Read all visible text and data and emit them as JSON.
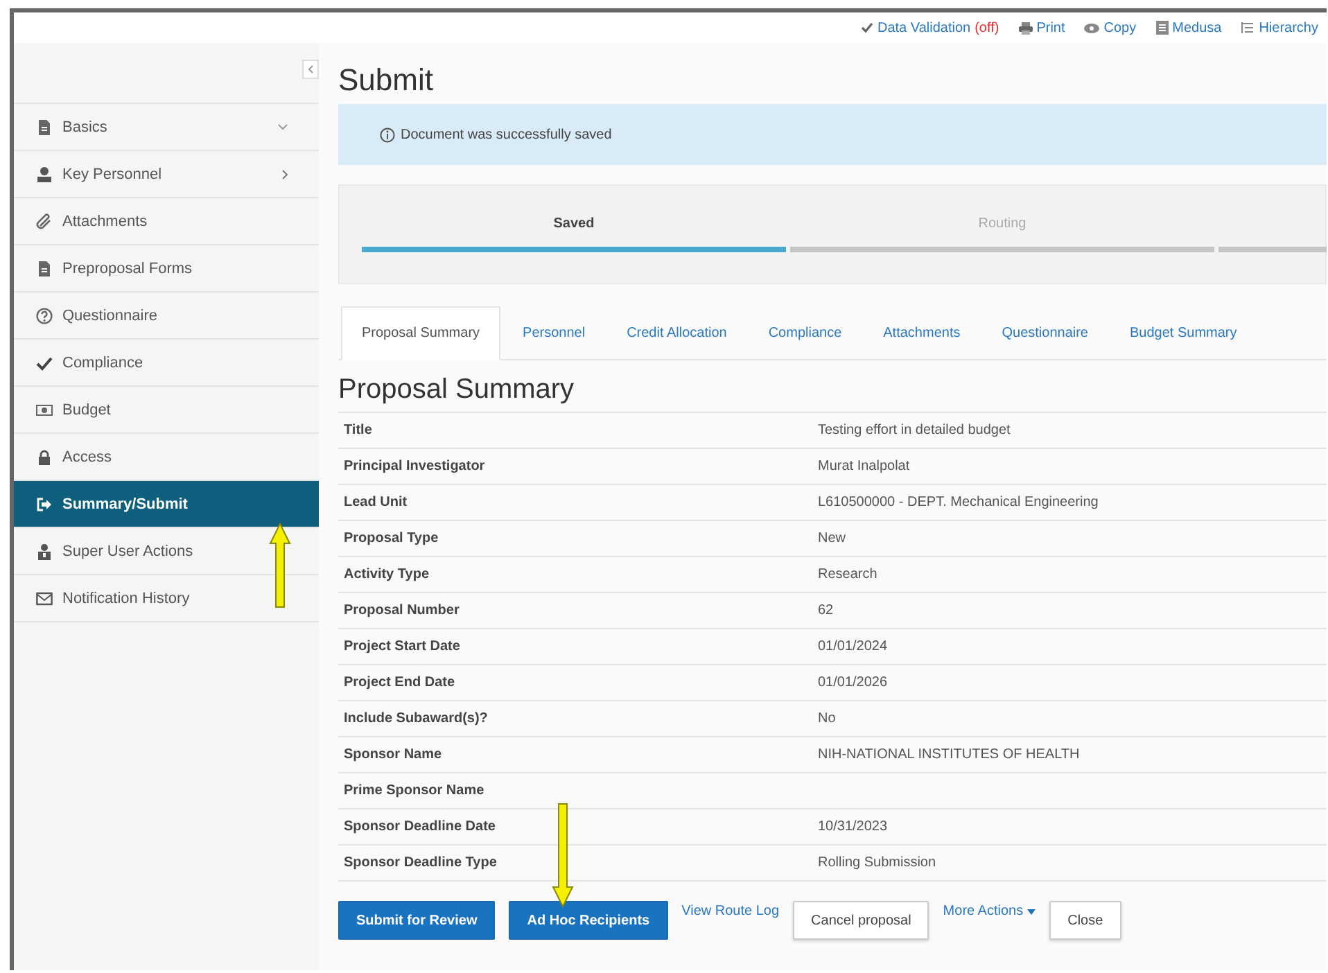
{
  "top_links": [
    {
      "kind": "check",
      "label": "Data Validation",
      "status": "(off)"
    },
    {
      "kind": "print",
      "label": "Print"
    },
    {
      "kind": "eye",
      "label": "Copy"
    },
    {
      "kind": "doc",
      "label": "Medusa"
    },
    {
      "kind": "tree",
      "label": "Hierarchy"
    }
  ],
  "sidebar": {
    "items": [
      {
        "label": "Basics",
        "expanded": true,
        "selected": false
      },
      {
        "label": "Key Personnel",
        "expanded": false,
        "selected": false
      },
      {
        "label": "Attachments",
        "selected": false
      },
      {
        "label": "Preproposal Forms",
        "selected": false
      },
      {
        "label": "Questionnaire",
        "selected": false
      },
      {
        "label": "Compliance",
        "selected": false
      },
      {
        "label": "Budget",
        "selected": false
      },
      {
        "label": "Access",
        "selected": false
      },
      {
        "label": "Summary/Submit",
        "selected": true
      },
      {
        "label": "Super User Actions",
        "selected": false
      },
      {
        "label": "Notification History",
        "selected": false
      }
    ]
  },
  "page_title": "Submit",
  "alert": "Document was successfully saved",
  "progress_steps": [
    {
      "label": "Saved",
      "completed": true
    },
    {
      "label": "Routing",
      "completed": false
    },
    {
      "completed": false
    }
  ],
  "tabs": [
    {
      "label": "Proposal Summary",
      "selected": true
    },
    {
      "label": "Personnel",
      "selected": false
    },
    {
      "label": "Credit Allocation",
      "selected": false
    },
    {
      "label": "Compliance",
      "selected": false
    },
    {
      "label": "Attachments",
      "selected": false
    },
    {
      "label": "Questionnaire",
      "selected": false
    },
    {
      "label": "Budget Summary",
      "selected": false
    }
  ],
  "summary": {
    "heading": "Proposal Summary",
    "rows": [
      {
        "label": "Title",
        "value": "Testing effort in detailed budget"
      },
      {
        "label": "Principal Investigator",
        "value": "Murat Inalpolat"
      },
      {
        "label": "Lead Unit",
        "value": "L610500000 - DEPT. Mechanical Engineering"
      },
      {
        "label": "Proposal Type",
        "value": "New"
      },
      {
        "label": "Activity Type",
        "value": "Research"
      },
      {
        "label": "Proposal Number",
        "value": "62"
      },
      {
        "label": "Project Start Date",
        "value": "01/01/2024"
      },
      {
        "label": "Project End Date",
        "value": "01/01/2026"
      },
      {
        "label": "Include Subaward(s)?",
        "value": "No"
      },
      {
        "label": "Sponsor Name",
        "value": "NIH-NATIONAL INSTITUTES OF HEALTH"
      },
      {
        "label": "Prime Sponsor Name"
      },
      {
        "label": "Sponsor Deadline Date",
        "value": "10/31/2023"
      },
      {
        "label": "Sponsor Deadline Type",
        "value": "Rolling Submission"
      }
    ]
  },
  "actions": [
    {
      "kind": "primary",
      "label": "Submit for Review"
    },
    {
      "kind": "primary",
      "label": "Ad Hoc Recipients"
    },
    {
      "kind": "link",
      "label": "View Route Log"
    },
    {
      "kind": "plain",
      "label": "Cancel proposal"
    },
    {
      "kind": "menu",
      "label": "More Actions"
    },
    {
      "kind": "plain",
      "label": "Close"
    }
  ]
}
